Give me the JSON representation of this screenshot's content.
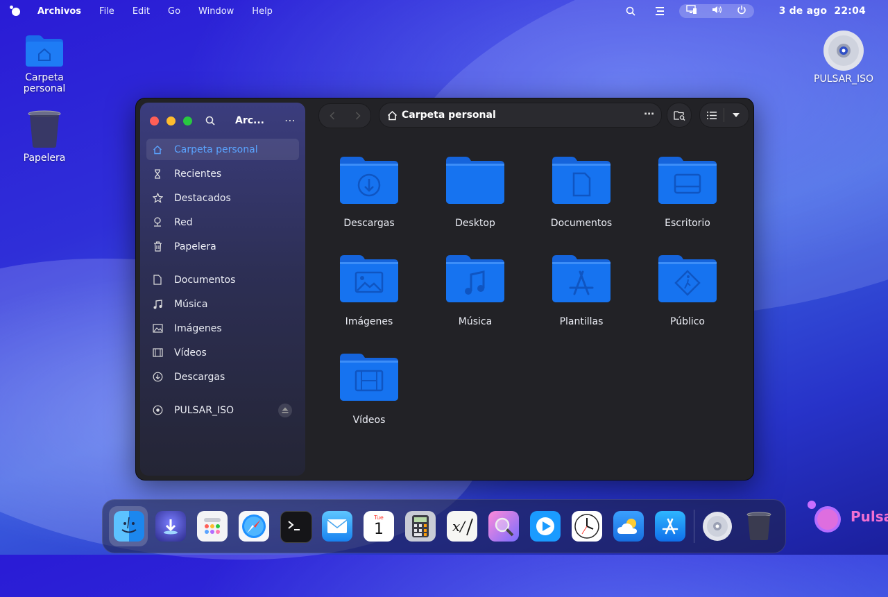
{
  "topbar": {
    "app_name": "Archivos",
    "menus": [
      "File",
      "Edit",
      "Go",
      "Window",
      "Help"
    ],
    "date": "3 de ago",
    "time": "22:04"
  },
  "desktop": {
    "home_label_line1": "Carpeta",
    "home_label_line2": "personal",
    "trash_label": "Papelera",
    "disc_label": "PULSAR_ISO"
  },
  "window": {
    "sidebar_title": "Arc...",
    "path": "Carpeta personal",
    "places": [
      {
        "label": "Carpeta personal",
        "icon": "home-icon",
        "active": true
      },
      {
        "label": "Recientes",
        "icon": "hourglass-icon"
      },
      {
        "label": "Destacados",
        "icon": "star-icon"
      },
      {
        "label": "Red",
        "icon": "network-icon"
      },
      {
        "label": "Papelera",
        "icon": "trash-icon"
      }
    ],
    "bookmarks": [
      {
        "label": "Documentos",
        "icon": "document-icon"
      },
      {
        "label": "Música",
        "icon": "music-icon"
      },
      {
        "label": "Imágenes",
        "icon": "image-icon"
      },
      {
        "label": "Vídeos",
        "icon": "film-icon"
      },
      {
        "label": "Descargas",
        "icon": "download-icon"
      }
    ],
    "devices": [
      {
        "label": "PULSAR_ISO",
        "icon": "disc-icon"
      }
    ],
    "folders": [
      {
        "label": "Descargas",
        "glyph": "download"
      },
      {
        "label": "Desktop",
        "glyph": "none"
      },
      {
        "label": "Documentos",
        "glyph": "document"
      },
      {
        "label": "Escritorio",
        "glyph": "desktop"
      },
      {
        "label": "Imágenes",
        "glyph": "image"
      },
      {
        "label": "Música",
        "glyph": "music"
      },
      {
        "label": "Plantillas",
        "glyph": "template"
      },
      {
        "label": "Público",
        "glyph": "public"
      },
      {
        "label": "Vídeos",
        "glyph": "film"
      }
    ]
  },
  "dock": {
    "apps": [
      "finder-icon",
      "downloader-icon",
      "launchpad-icon",
      "safari-icon",
      "terminal-icon",
      "mail-icon",
      "calendar-icon",
      "calculator-icon",
      "text-editor-icon",
      "image-viewer-icon",
      "media-player-icon",
      "clock-icon",
      "weather-icon",
      "app-store-icon",
      "disc-icon",
      "trash-icon"
    ],
    "calendar_month": "Tue",
    "calendar_day": "1"
  },
  "brand": {
    "text": "Pulsa"
  },
  "colors": {
    "accent": "#5aa4ff",
    "folder": "#1673f0",
    "brand": "#f06fd2"
  }
}
